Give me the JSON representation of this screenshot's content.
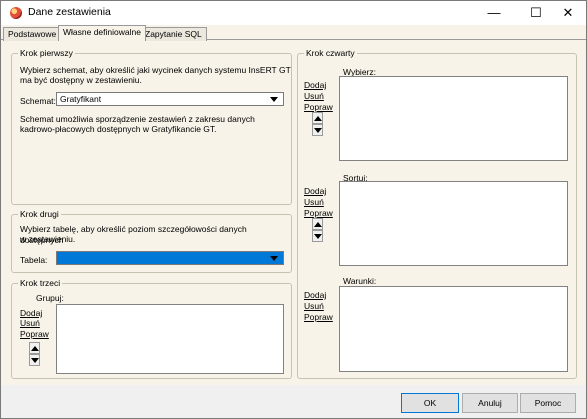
{
  "window": {
    "title": "Dane zestawienia",
    "minimize": "—",
    "maximize": "☐",
    "close": "✕"
  },
  "tabs": [
    {
      "label": "Podstawowe"
    },
    {
      "label": "Własne definiowalne"
    },
    {
      "label": "Zapytanie SQL"
    }
  ],
  "step1": {
    "title": "Krok pierwszy",
    "description_line1": "Wybierz schemat, aby określić jaki wycinek danych systemu InsERT GT",
    "description_line2": "ma być dostępny w zestawieniu.",
    "schema_label": "Schemat:",
    "schema_value": "Gratyfikant",
    "info_line1": "Schemat umożliwia sporządzenie zestawień z zakresu danych",
    "info_line2": "kadrowo-płacowych dostępnych w Gratyfikancie GT."
  },
  "step2": {
    "title": "Krok drugi",
    "description_line1": "Wybierz tabelę, aby określić poziom szczegółowości danych dostępnych",
    "description_line2": "w zestawieniu.",
    "table_label": "Tabela:",
    "table_value": ""
  },
  "step3": {
    "title": "Krok trzeci",
    "group_label": "Grupuj:",
    "add": "Dodaj",
    "remove": "Usuń",
    "edit": "Popraw"
  },
  "step4": {
    "title": "Krok czwarty",
    "select_label": "Wybierz:",
    "sort_label": "Sortuj:",
    "conditions_label": "Warunki:",
    "add": "Dodaj",
    "remove": "Usuń",
    "edit": "Popraw"
  },
  "buttons": {
    "ok": "OK",
    "cancel": "Anuluj",
    "help": "Pomoc"
  }
}
